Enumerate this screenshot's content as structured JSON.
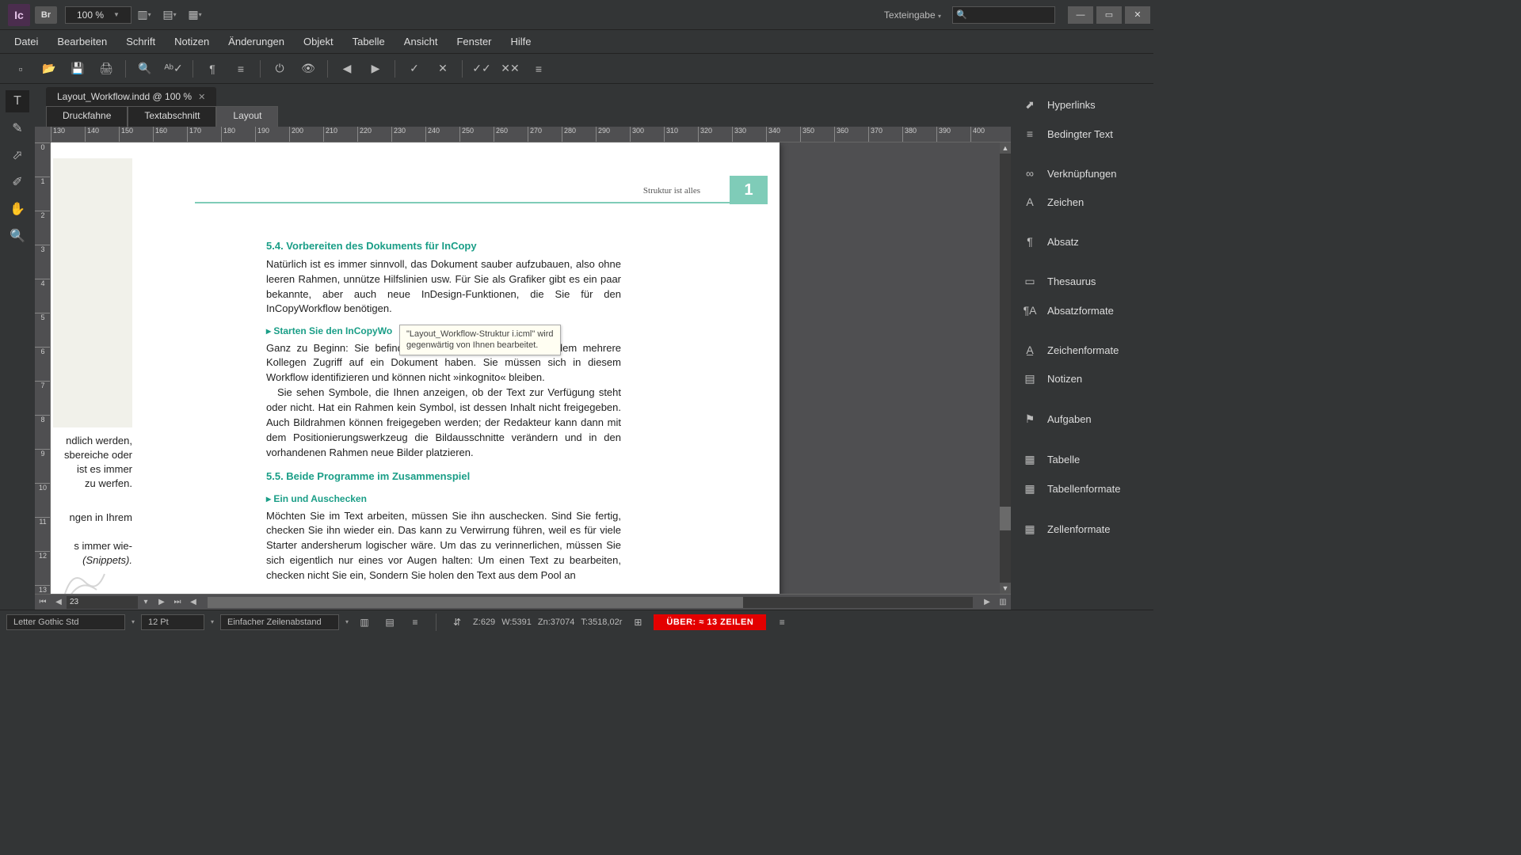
{
  "app": {
    "icon": "Ic",
    "bridge": "Br",
    "zoom": "100 %",
    "mode": "Texteingabe"
  },
  "menu": [
    "Datei",
    "Bearbeiten",
    "Schrift",
    "Notizen",
    "Änderungen",
    "Objekt",
    "Tabelle",
    "Ansicht",
    "Fenster",
    "Hilfe"
  ],
  "doc_tab": "Layout_Workflow.indd @ 100 %",
  "view_tabs": [
    "Druckfahne",
    "Textabschnitt",
    "Layout"
  ],
  "ruler_h": [
    "130",
    "140",
    "150",
    "160",
    "170",
    "180",
    "190",
    "200",
    "210",
    "220",
    "230",
    "240",
    "250",
    "260",
    "270",
    "280",
    "290",
    "300",
    "310",
    "320",
    "330",
    "340",
    "350",
    "360",
    "370",
    "380",
    "390",
    "400"
  ],
  "ruler_v": [
    "0",
    "1",
    "2",
    "3",
    "4",
    "5",
    "6",
    "7",
    "8",
    "9",
    "10",
    "11",
    "12",
    "13"
  ],
  "page": {
    "header_txt": "Struktur ist alles",
    "header_num": "1",
    "sec1_h": "5.4.  Vorbereiten des Dokuments für InCopy",
    "sec1_p": "Natürlich ist es immer sinnvoll, das Dokument sauber aufzubauen, also ohne leeren Rahmen, unnütze Hilfslinien usw. Für Sie als Grafiker gibt es ein paar bekannte, aber auch neue InDesign-Funktionen, die Sie für den InCopyWorkflow benötigen.",
    "sub1_h": "Starten Sie den InCopyWo",
    "sub1_p1": "Ganz zu Beginn: Sie befinden sich in einem Workflow, in dem mehrere Kollegen Zugriff auf ein Dokument haben. Sie müssen sich in diesem Workflow identifizieren und können nicht »inkognito« bleiben.",
    "sub1_p2": "Sie sehen Symbole, die Ihnen anzeigen, ob der Text zur Verfügung steht oder nicht. Hat ein Rahmen kein Symbol, ist dessen Inhalt nicht freigegeben. Auch Bildrahmen können freigegeben werden; der Redakteur kann dann mit dem Positionierungswerkzeug die Bildausschnitte verändern und in den vorhandenen Rahmen neue Bilder platzieren.",
    "sec2_h": "5.5.  Beide Programme im Zusammenspiel",
    "sub2_h": "Ein und Auschecken",
    "sub2_p": "Möchten Sie im Text arbeiten, müssen Sie ihn auschecken. Sind Sie fertig, checken Sie ihn wieder ein. Das kann zu Verwirrung führen, weil es für viele Starter andersherum logischer wäre. Um das zu verinnerlichen, müssen Sie sich eigentlich nur eines vor Augen halten: Um einen Text zu bearbeiten, checken nicht Sie ein, Sondern Sie holen den Text aus dem Pool an",
    "overflow": {
      "l1": "ndlich werden,",
      "l2": "sbereiche oder",
      "l3": "ist es immer",
      "l4": "zu werfen.",
      "l5": "ngen in Ihrem",
      "l6": "s immer wie-",
      "l7": "(Snippets)."
    }
  },
  "tooltip": {
    "l1": "\"Layout_Workflow-Struktur i.icml\" wird",
    "l2": "gegenwärtig von Ihnen bearbeitet."
  },
  "panels": [
    "Hyperlinks",
    "Bedingter Text",
    "Verknüpfungen",
    "Zeichen",
    "Absatz",
    "Thesaurus",
    "Absatzformate",
    "Zeichenformate",
    "Notizen",
    "Aufgaben",
    "Tabelle",
    "Tabellenformate",
    "Zellenformate"
  ],
  "panel_icons": [
    "⬈",
    "≡",
    "∞",
    "A",
    "¶",
    "▭",
    "¶A",
    "A̲",
    "▤",
    "⚑",
    "▦",
    "▦",
    "▦"
  ],
  "nav": {
    "page": "23"
  },
  "status": {
    "font": "Letter Gothic Std",
    "size": "12 Pt",
    "leading": "Einfacher Zeilenabstand",
    "z": "Z:629",
    "w": "W:5391",
    "zn": "Zn:37074",
    "t": "T:3518,02r",
    "overset": "ÜBER:  ≈ 13 ZEILEN"
  }
}
